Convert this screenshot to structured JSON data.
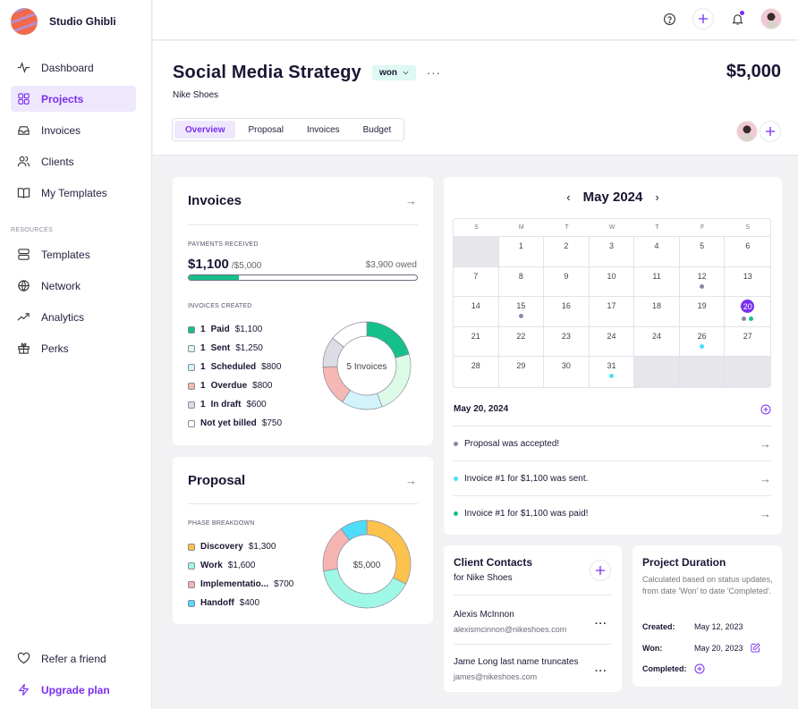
{
  "brand": {
    "name": "Studio Ghibli"
  },
  "sidebar": {
    "items": [
      {
        "label": "Dashboard",
        "icon": "activity-icon"
      },
      {
        "label": "Projects",
        "icon": "grid-icon",
        "active": true
      },
      {
        "label": "Invoices",
        "icon": "inbox-icon"
      },
      {
        "label": "Clients",
        "icon": "users-icon"
      },
      {
        "label": "My Templates",
        "icon": "book-icon"
      }
    ],
    "resources_label": "RESOURCES",
    "resources": [
      {
        "label": "Templates",
        "icon": "template-icon"
      },
      {
        "label": "Network",
        "icon": "globe-icon"
      },
      {
        "label": "Analytics",
        "icon": "trending-icon"
      },
      {
        "label": "Perks",
        "icon": "gift-icon"
      }
    ],
    "footer": [
      {
        "label": "Refer a friend",
        "icon": "heart-icon"
      },
      {
        "label": "Upgrade plan",
        "icon": "lightning-icon"
      }
    ]
  },
  "topbar": {
    "help": "help-icon",
    "add": "plus-icon",
    "notifications": "bell-icon",
    "has_notification": true
  },
  "project": {
    "title": "Social Media Strategy",
    "status": "won",
    "client": "Nike Shoes",
    "amount": "$5,000",
    "tabs": [
      "Overview",
      "Proposal",
      "Invoices",
      "Budget"
    ],
    "active_tab": "Overview"
  },
  "invoices_card": {
    "title": "Invoices",
    "payments_label": "PAYMENTS RECEIVED",
    "received": "$1,100",
    "total": "/$5,000",
    "owed": "$3,900 owed",
    "progress": 0.22,
    "created_label": "INVOICES CREATED",
    "center_label": "5 Invoices",
    "items": [
      {
        "count": "1",
        "label": "Paid",
        "amount": "$1,100",
        "value": 1100,
        "color": "#16c08a"
      },
      {
        "count": "1",
        "label": "Sent",
        "amount": "$1,250",
        "value": 1250,
        "color": "#dcfbe6"
      },
      {
        "count": "1",
        "label": "Scheduled",
        "amount": "$800",
        "value": 800,
        "color": "#d3f3fb"
      },
      {
        "count": "1",
        "label": "Overdue",
        "amount": "$800",
        "value": 800,
        "color": "#f5b8b4"
      },
      {
        "count": "1",
        "label": "In draft",
        "amount": "$600",
        "value": 600,
        "color": "#dcdce4"
      },
      {
        "count": "",
        "label": "Not yet billed",
        "amount": "$750",
        "value": 750,
        "color": "#ffffff"
      }
    ]
  },
  "proposal_card": {
    "title": "Proposal",
    "phase_label": "PHASE BREAKDOWN",
    "center_label": "$5,000",
    "items": [
      {
        "label": "Discovery",
        "amount": "$1,300",
        "value": 1300,
        "color": "#fdc24d"
      },
      {
        "label": "Work",
        "amount": "$1,600",
        "value": 1600,
        "color": "#9ff8e6"
      },
      {
        "label": "Implementatio...",
        "amount": "$700",
        "value": 700,
        "color": "#f6b4b0"
      },
      {
        "label": "Handoff",
        "amount": "$400",
        "value": 400,
        "color": "#4fdcfb"
      }
    ]
  },
  "calendar": {
    "month": "May 2024",
    "weekdays": [
      "S",
      "M",
      "T",
      "W",
      "T",
      "F",
      "S"
    ],
    "weeks": [
      [
        null,
        "1",
        "2",
        "3",
        "4",
        "5",
        "6"
      ],
      [
        "7",
        "8",
        "9",
        "10",
        "11",
        "12",
        "13"
      ],
      [
        "14",
        "15",
        "16",
        "17",
        "18",
        "19",
        "20"
      ],
      [
        "21",
        "22",
        "23",
        "24",
        "24",
        "26",
        "27"
      ],
      [
        "28",
        "29",
        "30",
        "31",
        null,
        null,
        null
      ]
    ],
    "today": "20",
    "markers": {
      "12": [
        "#8a88a0"
      ],
      "15": [
        "#8a88a0"
      ],
      "20": [
        "#8a88a0",
        "#16c08a"
      ],
      "26": [
        "#4fdcfb"
      ],
      "31": [
        "#4fdcfb"
      ]
    },
    "selected_date": "May 20, 2024",
    "events": [
      {
        "text": "Proposal was accepted!",
        "color": "#8a88a0"
      },
      {
        "text": "Invoice #1 for $1,100 was sent.",
        "color": "#4fdcfb"
      },
      {
        "text": "Invoice #1 for $1,100 was paid!",
        "color": "#16c08a"
      }
    ]
  },
  "contacts": {
    "title": "Client Contacts",
    "subtitle": "for Nike Shoes",
    "items": [
      {
        "name": "Alexis McInnon",
        "email": "alexismcinnon@nikeshoes.com"
      },
      {
        "name": "Jame Long last name truncates",
        "email": "james@nikeshoes.com"
      }
    ]
  },
  "duration": {
    "title": "Project Duration",
    "description": "Calculated based on status updates, from date 'Won' to date 'Completed'.",
    "created_label": "Created:",
    "created": "May 12, 2023",
    "won_label": "Won:",
    "won": "May 20, 2023",
    "completed_label": "Completed:"
  },
  "colors": {
    "accent": "#7a2ff0",
    "text": "#1c1433",
    "background": "#f2f2f5"
  }
}
